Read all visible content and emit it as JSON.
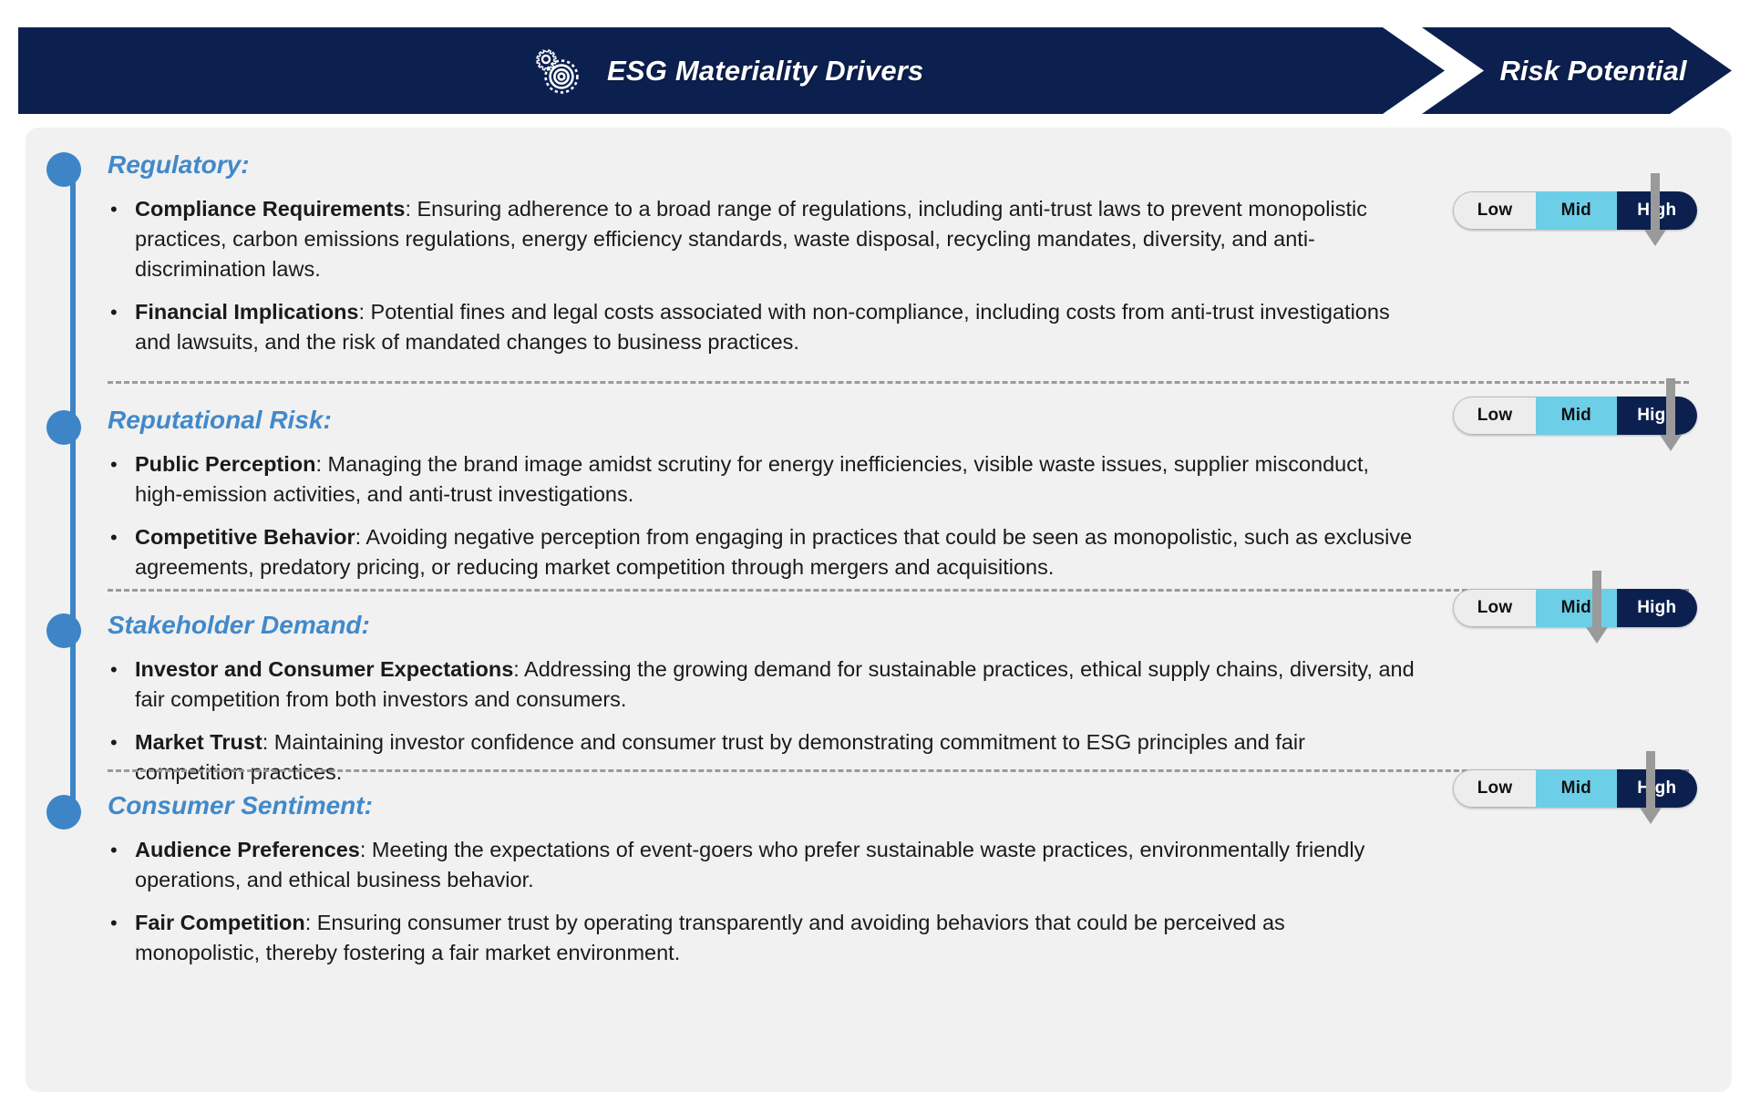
{
  "header": {
    "icon": "gears-icon",
    "title": "ESG Materiality Drivers",
    "tail_title": "Risk Potential",
    "navy": "#0C2050"
  },
  "meter_legend": {
    "low": "Low",
    "mid": "Mid",
    "high": "High",
    "low_color": "#EDEDED",
    "mid_color": "#6DCEE8",
    "high_color": "#0C2050",
    "marker_color": "#9A9A9A"
  },
  "accent_blue": "#4189CA",
  "panel_bg": "#F1F1F1",
  "sections": [
    {
      "heading": "Regulatory:",
      "bullets": [
        {
          "term": "Compliance Requirements",
          "text": ": Ensuring adherence to a broad range of regulations, including anti-trust laws to prevent monopolistic practices, carbon emissions regulations, energy efficiency standards, waste disposal, recycling mandates, diversity, and anti-discrimination laws."
        },
        {
          "term": "Financial Implications",
          "text": ": Potential fines and legal costs associated with non-compliance, including costs from anti-trust investigations and lawsuits, and the risk of mandated changes to business practices."
        }
      ],
      "risk": {
        "level": "High",
        "marker_percent": 83
      }
    },
    {
      "heading": "Reputational Risk:",
      "bullets": [
        {
          "term": "Public Perception",
          "text": ": Managing the brand image amidst scrutiny for energy inefficiencies, visible waste issues, supplier misconduct, high-emission activities, and anti-trust investigations."
        },
        {
          "term": "Competitive Behavior",
          "text": ": Avoiding negative perception from engaging in practices that could be seen as monopolistic, such as exclusive agreements, predatory pricing, or reducing market competition through mergers and acquisitions."
        }
      ],
      "risk": {
        "level": "High",
        "marker_percent": 89
      }
    },
    {
      "heading": "Stakeholder Demand:",
      "bullets": [
        {
          "term": "Investor and Consumer Expectations",
          "text": ": Addressing the growing demand for sustainable practices, ethical supply chains, diversity, and fair competition from both investors and consumers."
        },
        {
          "term": "Market Trust",
          "text": ": Maintaining investor confidence and consumer trust by demonstrating commitment to ESG principles and fair competition practices."
        }
      ],
      "risk": {
        "level": "Mid",
        "marker_percent": 59
      }
    },
    {
      "heading": "Consumer Sentiment:",
      "bullets": [
        {
          "term": "Audience Preferences",
          "text": ": Meeting the expectations of event-goers who prefer sustainable waste practices, environmentally friendly operations, and ethical business behavior."
        },
        {
          "term": "Fair Competition",
          "text": ": Ensuring consumer trust by operating transparently and avoiding behaviors that could be perceived as monopolistic, thereby fostering a fair market environment."
        }
      ],
      "risk": {
        "level": "High",
        "marker_percent": 81
      }
    }
  ]
}
